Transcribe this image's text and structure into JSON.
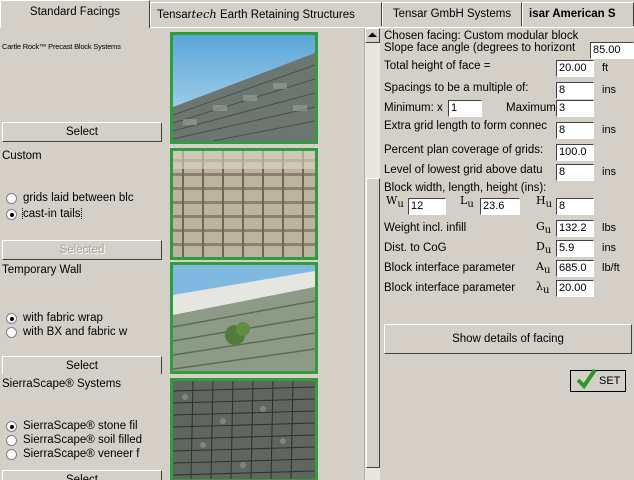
{
  "tabs": [
    {
      "label": "Standard Facings"
    },
    {
      "prefix": "Tensar",
      "brand": "tech",
      "suffix": " Earth Retaining Structures"
    },
    {
      "label": "Tensar GmbH Systems"
    },
    {
      "label": "isar American S"
    }
  ],
  "facings": [
    {
      "name": "Cartle Rock™ Precast Block Systems",
      "button": "Select",
      "options": []
    },
    {
      "name": "Custom",
      "button": "Selected",
      "options": [
        {
          "label": "grids laid between blc",
          "checked": false
        },
        {
          "label": "cast-in tails",
          "checked": true
        }
      ]
    },
    {
      "name": "Temporary Wall",
      "button": "Select",
      "options": [
        {
          "label": "with fabric wrap",
          "checked": true
        },
        {
          "label": "with BX and fabric w",
          "checked": false
        }
      ]
    },
    {
      "name": "SierraScape® Systems",
      "button": "Select",
      "options": [
        {
          "label": "SierraScape® stone fil",
          "checked": true
        },
        {
          "label": "SierraScape® soil filled",
          "checked": false
        },
        {
          "label": "SierraScape® veneer f",
          "checked": false
        }
      ]
    }
  ],
  "panel": {
    "chosen": "Chosen facing: Custom modular block",
    "slope_label": "Slope face angle (degrees to horizont",
    "slope_value": "85.00",
    "height_label": "Total height of face =",
    "height_value": "20.00",
    "height_unit": "ft",
    "spacing_label": "Spacings to be a multiple of:",
    "spacing_value": "8",
    "spacing_unit": "ins",
    "min_label": "Minimum: x",
    "min_value": "1",
    "max_label": "Maximum",
    "max_value": "3",
    "extra_label": "Extra grid length to form connec",
    "extra_value": "8",
    "extra_unit": "ins",
    "coverage_label": "Percent plan coverage of grids:",
    "coverage_value": "100.0",
    "lowest_label": "Level of lowest grid above datu",
    "lowest_value": "8",
    "lowest_unit": "ins",
    "block_label": "Block width, length, height (ins):",
    "wu_sym": "W",
    "wu_value": "12",
    "lu_sym": "L",
    "lu_value": "23.6",
    "hu_sym": "H",
    "hu_value": "8",
    "weight_label": "Weight incl. infill",
    "weight_sym": "G",
    "weight_value": "132.2",
    "weight_unit": "lbs",
    "cog_label": "Dist. to CoG",
    "cog_sym": "D",
    "cog_value": "5.9",
    "cog_unit": "ins",
    "iface1_label": "Block interface parameter",
    "iface1_sym": "A",
    "iface1_value": "685.0",
    "iface1_unit": "lb/ft",
    "iface2_label": "Block interface parameter",
    "iface2_sym": "λ",
    "iface2_value": "20.00",
    "sub_u": "u",
    "details_button": "Show details of facing",
    "set_button": "SET"
  },
  "colors": {
    "selected_border": "#2f9e3a",
    "set_check": "#2a9a2a"
  }
}
